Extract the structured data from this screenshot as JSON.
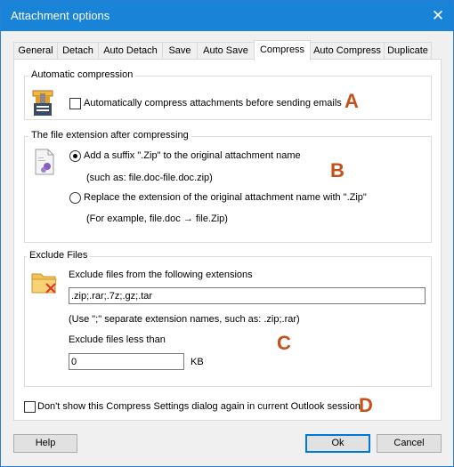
{
  "window": {
    "title": "Attachment options",
    "close_icon": "✕"
  },
  "tabs": [
    {
      "label": "General"
    },
    {
      "label": "Detach"
    },
    {
      "label": "Auto Detach"
    },
    {
      "label": "Save"
    },
    {
      "label": "Auto Save"
    },
    {
      "label": "Compress",
      "active": true
    },
    {
      "label": "Auto Compress"
    },
    {
      "label": "Duplicate"
    }
  ],
  "auto_compression": {
    "title": "Automatic compression",
    "checkbox_label": "Automatically compress attachments before sending emails",
    "checked": false,
    "marker": "A"
  },
  "extension": {
    "title": "The file extension after compressing",
    "option1_label": "Add a suffix \".Zip\" to the original attachment name",
    "option1_example": "(such as: file.doc-file.doc.zip)",
    "option2_label": "Replace the extension of the original attachment name with \".Zip\"",
    "option2_example": "(For example, file.doc → file.Zip)",
    "selected": "option1",
    "marker": "B"
  },
  "exclude": {
    "title": "Exclude Files",
    "extensions_label": "Exclude files from the following extensions",
    "extensions_value": ".zip;.rar;.7z;.gz;.tar",
    "hint": "(Use \";\" separate extension names, such as: .zip;.rar)",
    "size_label": "Exclude files less than",
    "size_value": "0",
    "size_unit": "KB",
    "marker": "C"
  },
  "dont_show": {
    "label": "Don't show this Compress Settings dialog again in current Outlook session.",
    "checked": false,
    "marker": "D"
  },
  "buttons": {
    "help": "Help",
    "ok": "Ok",
    "cancel": "Cancel"
  },
  "colors": {
    "titlebar": "#1883d7",
    "marker": "#c4501a",
    "default_button_border": "#0078d7"
  }
}
